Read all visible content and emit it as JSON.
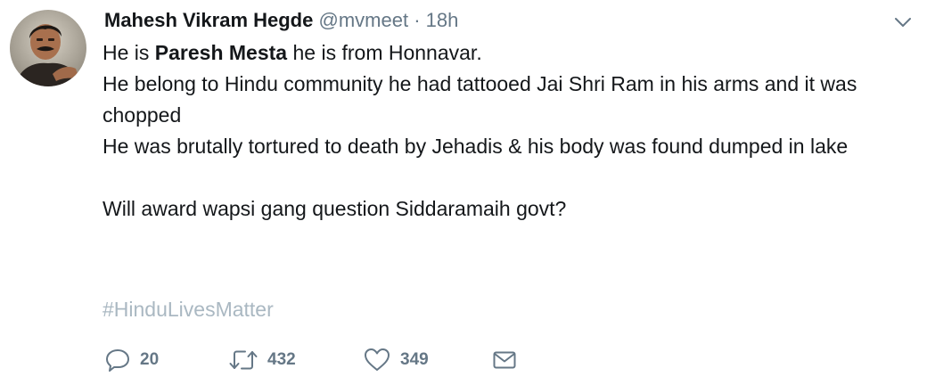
{
  "tweet": {
    "author": {
      "display_name": "Mahesh Vikram Hegde",
      "handle": "@mvmeet",
      "separator": "·",
      "time": "18h"
    },
    "text": {
      "line1_pre": "He is ",
      "line1_bold": "Paresh Mesta",
      "line1_post": " he is from Honnavar.",
      "line2": "He belong to Hindu community he had tattooed Jai Shri Ram in his arms and it was chopped",
      "line3": "He was brutally tortured to death by Jehadis & his body was found dumped in lake",
      "line4": "Will award wapsi gang question Siddaramaih govt?"
    },
    "hashtag": "#HinduLivesMatter",
    "actions": {
      "reply_icon": "reply-icon",
      "reply_count": "20",
      "retweet_icon": "retweet-icon",
      "retweet_count": "432",
      "like_icon": "heart-icon",
      "like_count": "349",
      "dm_icon": "envelope-icon"
    },
    "colors": {
      "text": "#14171a",
      "secondary": "#657786",
      "hashtag": "#aab8c2"
    }
  }
}
